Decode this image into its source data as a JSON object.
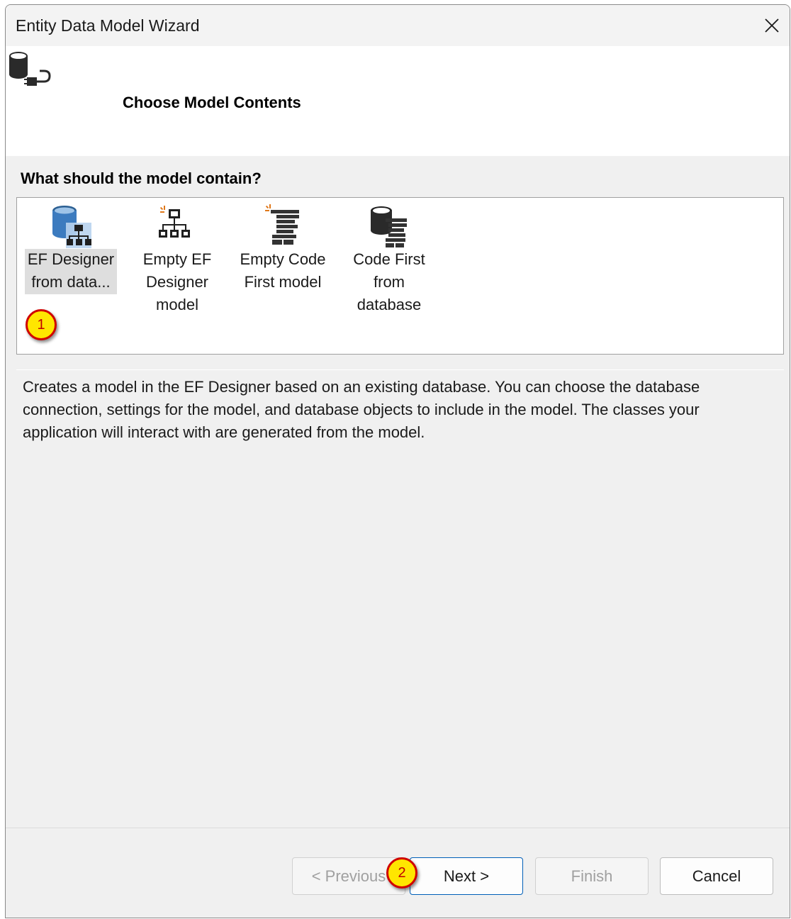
{
  "window": {
    "title": "Entity Data Model Wizard",
    "close_icon": "close-icon"
  },
  "header": {
    "title": "Choose Model Contents",
    "icon": "database-plug-icon"
  },
  "question": "What should the model contain?",
  "options": [
    {
      "label_line1": "EF Designer",
      "label_line2": "from data...",
      "label_line3": "",
      "icon": "ef-designer-database-icon",
      "selected": true
    },
    {
      "label_line1": "Empty EF",
      "label_line2": "Designer",
      "label_line3": "model",
      "icon": "empty-ef-designer-icon",
      "selected": false
    },
    {
      "label_line1": "Empty Code",
      "label_line2": "First model",
      "label_line3": "",
      "icon": "empty-code-first-icon",
      "selected": false
    },
    {
      "label_line1": "Code First",
      "label_line2": "from",
      "label_line3": "database",
      "icon": "code-first-database-icon",
      "selected": false
    }
  ],
  "description": "Creates a model in the EF Designer based on an existing database. You can choose the database connection, settings for the model, and database objects to include in the model. The classes your application will interact with are generated from the model.",
  "buttons": {
    "previous": "< Previous",
    "next": "Next >",
    "finish": "Finish",
    "cancel": "Cancel"
  },
  "annotations": {
    "step1": "1",
    "step2": "2"
  },
  "colors": {
    "accent": "#005fb8",
    "badge_fill": "#ffe600",
    "badge_border": "#d00000",
    "icon_blue": "#3c7bbf"
  }
}
